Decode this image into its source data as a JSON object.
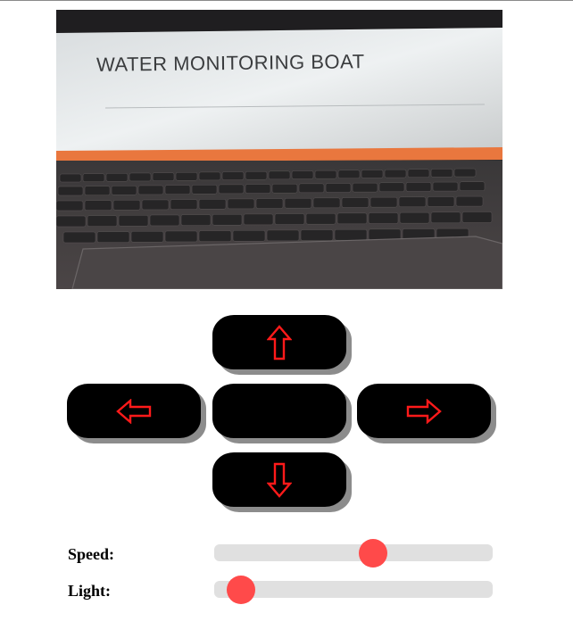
{
  "camera_feed": {
    "caption": "WATER MONITORING BOAT"
  },
  "controls": {
    "up": {
      "icon": "arrow-up-icon"
    },
    "left": {
      "icon": "arrow-left-icon"
    },
    "center": {
      "icon": ""
    },
    "right": {
      "icon": "arrow-right-icon"
    },
    "down": {
      "icon": "arrow-down-icon"
    },
    "arrow_color": "#ff1a1a",
    "button_color": "#000000"
  },
  "sliders": {
    "speed": {
      "label": "Speed:",
      "value": 0.58
    },
    "light": {
      "label": "Light:",
      "value": 0.05
    },
    "thumb_color": "#ff4a4a",
    "track_color": "#e0e0e0"
  }
}
